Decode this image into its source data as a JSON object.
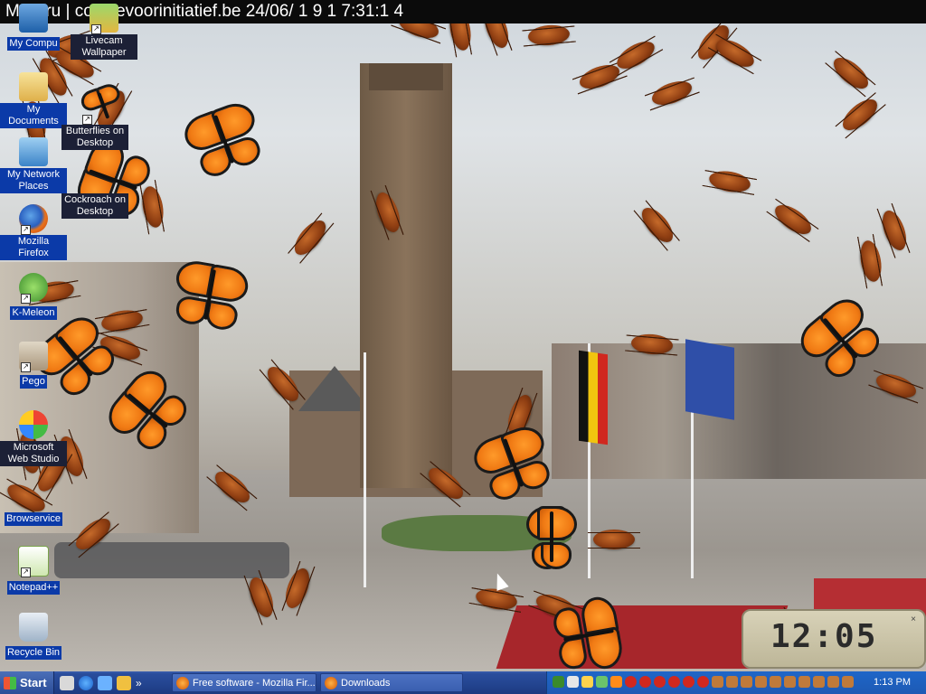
{
  "window": {
    "title": "M   t Bru   | comitevoorinitiatief.be 24/06/ 1 9  1 7:31:1 4"
  },
  "desktop_icons": [
    {
      "name": "my-computer-icon",
      "label": "My Compu",
      "dark": false
    },
    {
      "name": "livecam-wallpaper-icon",
      "label": "Livecam Wallpaper",
      "dark": true
    },
    {
      "name": "my-documents-icon",
      "label": "My Documents",
      "dark": false
    },
    {
      "name": "butterflies-on-desktop-icon",
      "label": "Butterflies on Desktop",
      "dark": true
    },
    {
      "name": "my-network-places-icon",
      "label": "My Network Places",
      "dark": false
    },
    {
      "name": "cockroach-on-desktop-icon",
      "label": "Cockroach on Desktop",
      "dark": true
    },
    {
      "name": "mozilla-firefox-icon",
      "label": "Mozilla Firefox",
      "dark": false
    },
    {
      "name": "k-meleon-icon",
      "label": "K-Meleon",
      "dark": false
    },
    {
      "name": "pego-icon",
      "label": "Pego",
      "dark": false
    },
    {
      "name": "msn-icon",
      "label": "Microsoft Web Studio",
      "dark": true
    },
    {
      "name": "browservice-icon",
      "label": "Browservice",
      "dark": false
    },
    {
      "name": "notepad-plus-plus-icon",
      "label": "Notepad++",
      "dark": false
    },
    {
      "name": "recycle-bin-icon",
      "label": "Recycle Bin",
      "dark": false
    }
  ],
  "clock": {
    "time": "12:05"
  },
  "taskbar": {
    "start_label": "Start",
    "overflow_glyph": "»",
    "tasks": [
      {
        "label": "Free software - Mozilla Fir..."
      },
      {
        "label": "Downloads"
      }
    ],
    "time": "1:13 PM"
  }
}
